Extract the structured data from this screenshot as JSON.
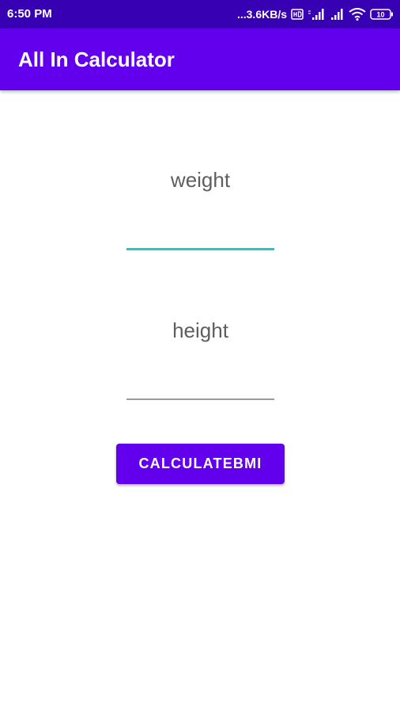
{
  "status_bar": {
    "time": "6:50 PM",
    "net_speed": "...3.6KB/s",
    "battery_level": "10",
    "icons": [
      "hd-volte-icon",
      "signal-strength-icon",
      "signal-strength-icon",
      "wifi-icon",
      "battery-icon"
    ]
  },
  "app_bar": {
    "title": "All In Calculator"
  },
  "form": {
    "weight_label": "weight",
    "weight_value": "",
    "height_label": "height",
    "height_value": "",
    "calculate_button_label": "CALCULATEBMI"
  },
  "colors": {
    "status_bar": "#3700b3",
    "app_bar": "#6200ee",
    "button": "#6200ee",
    "focused_underline": "#1fc9c0",
    "unfocused_underline": "#9a9a9a",
    "label_text": "#5e5e5e"
  }
}
